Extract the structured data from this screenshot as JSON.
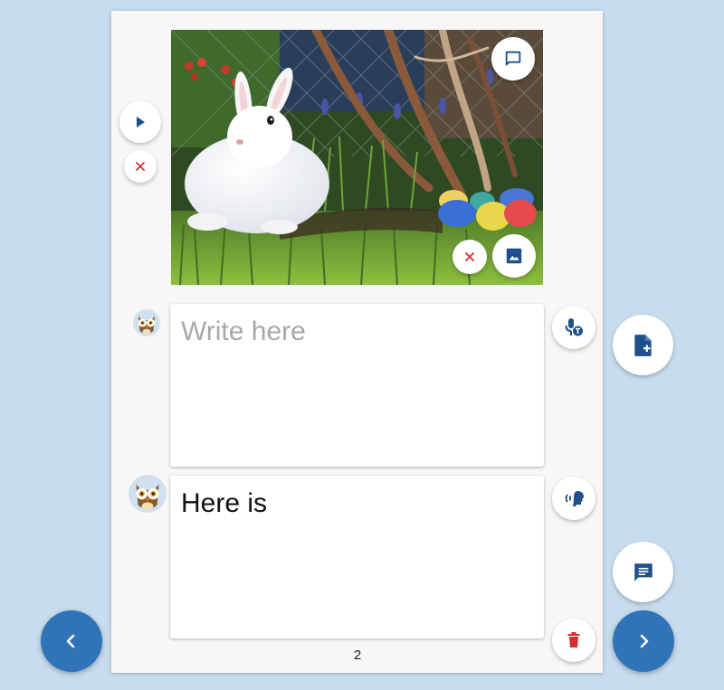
{
  "editor": {
    "text_blocks": [
      {
        "placeholder": "Write here",
        "value": ""
      },
      {
        "placeholder": "",
        "value": "Here is"
      }
    ],
    "page_number": "2"
  },
  "icons": {
    "play": "play-icon",
    "remove": "close-icon",
    "comment": "chat-bubble-outline-icon",
    "image": "image-icon",
    "speech_to_text": "mic-text-icon",
    "text_to_speech": "speaking-head-icon",
    "delete": "trash-icon",
    "add_page": "note-add-icon",
    "add_comment": "comment-filled-icon",
    "prev": "chevron-left-icon",
    "next": "chevron-right-icon"
  },
  "colors": {
    "background": "#c7ddee",
    "accent": "#2f73b9",
    "icon_blue": "#1f4f8c",
    "remove_red": "#d32f2f"
  }
}
